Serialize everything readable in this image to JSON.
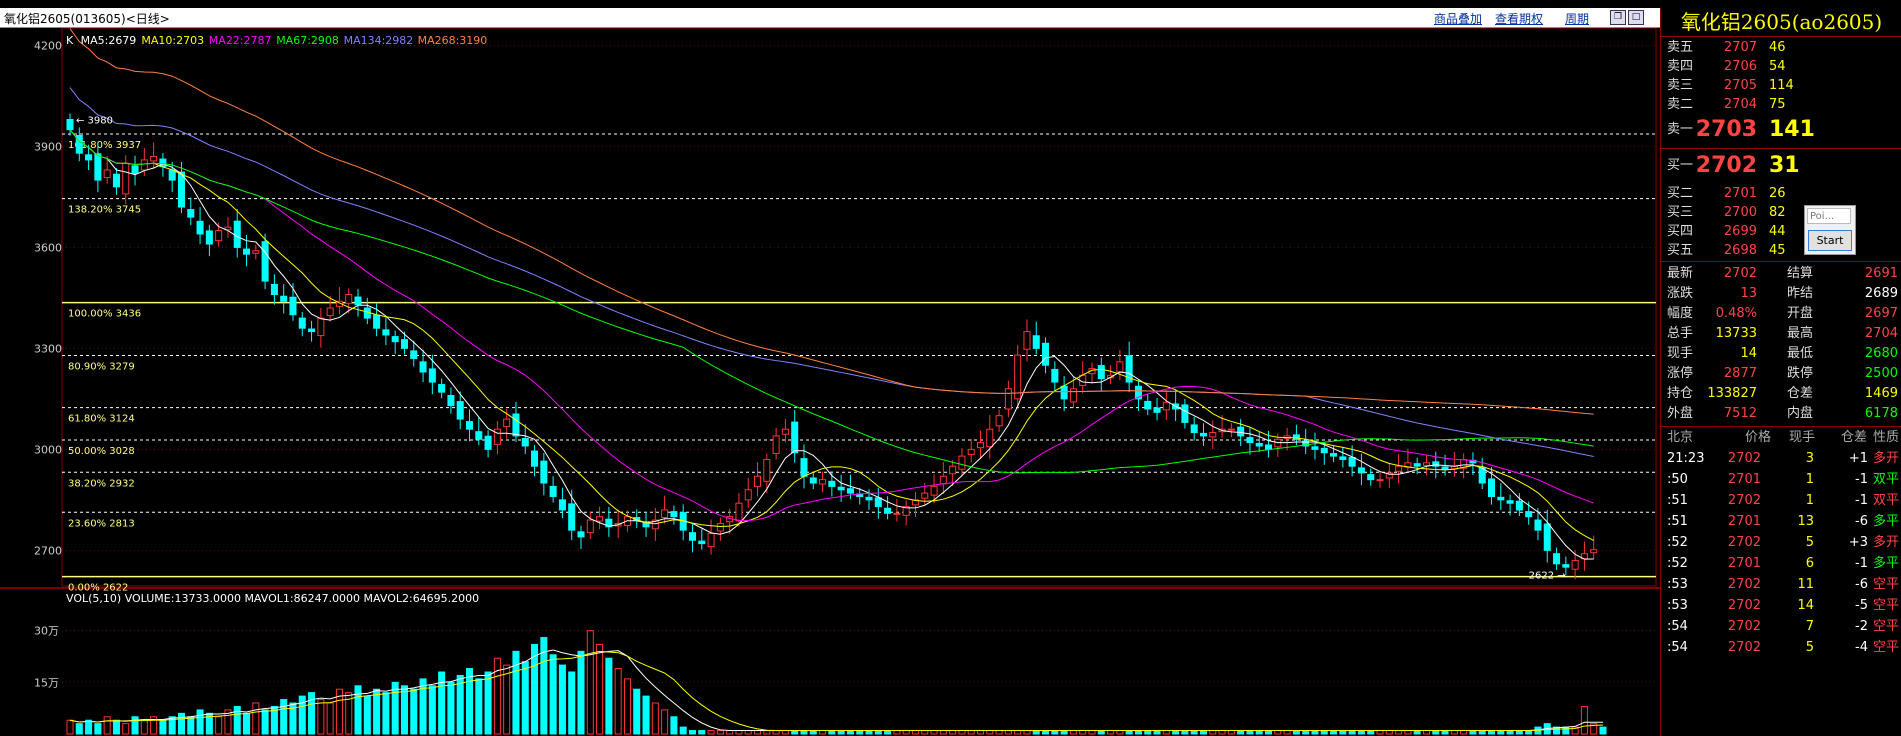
{
  "window": {
    "title": "氧化铝2605(013605)<日线>",
    "links": [
      "商品叠加",
      "查看期权",
      "周期"
    ]
  },
  "chart_data": [
    {
      "type": "candlestick",
      "title": "",
      "legend": [
        {
          "text": "K",
          "color": "#ffffff"
        },
        {
          "text": "MA5:2679",
          "color": "#ffffff"
        },
        {
          "text": "MA10:2703",
          "color": "#ffff00"
        },
        {
          "text": "MA22:2787",
          "color": "#ff00ff"
        },
        {
          "text": "MA67:2908",
          "color": "#00ff00"
        },
        {
          "text": "MA134:2982",
          "color": "#8080ff"
        },
        {
          "text": "MA268:3190",
          "color": "#ff8040"
        }
      ],
      "yticks": [
        4200,
        3900,
        3600,
        3300,
        3000,
        2700
      ],
      "ylim": [
        2600,
        4240
      ],
      "fib_levels": [
        {
          "label": "161.80% 3937",
          "value": 3937,
          "solid": false
        },
        {
          "label": "138.20% 3745",
          "value": 3745,
          "solid": false
        },
        {
          "label": "100.00% 3436",
          "value": 3436,
          "solid": true
        },
        {
          "label": "80.90% 3279",
          "value": 3279,
          "solid": false
        },
        {
          "label": "61.80% 3124",
          "value": 3124,
          "solid": false
        },
        {
          "label": "50.00% 3028",
          "value": 3028,
          "solid": false
        },
        {
          "label": "38.20% 2932",
          "value": 2932,
          "solid": false
        },
        {
          "label": "23.60% 2813",
          "value": 2813,
          "solid": false
        },
        {
          "label": "0.00% 2622",
          "value": 2622,
          "solid": true
        }
      ],
      "annotations": [
        {
          "text": "3980",
          "value": 3980
        },
        {
          "text": "2622",
          "value": 2622
        }
      ],
      "close": [
        3950,
        3880,
        3860,
        3800,
        3830,
        3780,
        3850,
        3820,
        3860,
        3870,
        3840,
        3800,
        3720,
        3690,
        3640,
        3610,
        3650,
        3660,
        3600,
        3580,
        3590,
        3500,
        3460,
        3440,
        3400,
        3360,
        3350,
        3390,
        3420,
        3440,
        3460,
        3430,
        3390,
        3360,
        3340,
        3320,
        3300,
        3270,
        3230,
        3200,
        3170,
        3130,
        3090,
        3060,
        3030,
        3000,
        3060,
        3090,
        3040,
        3010,
        2950,
        2900,
        2860,
        2820,
        2760,
        2740,
        2790,
        2800,
        2770,
        2780,
        2800,
        2790,
        2770,
        2790,
        2820,
        2800,
        2760,
        2730,
        2720,
        2750,
        2780,
        2800,
        2840,
        2880,
        2920,
        2970,
        3040,
        3060,
        2990,
        2920,
        2900,
        2910,
        2890,
        2880,
        2870,
        2860,
        2850,
        2830,
        2810,
        2810,
        2830,
        2850,
        2870,
        2890,
        2920,
        2950,
        2980,
        3000,
        3020,
        3060,
        3100,
        3180,
        3280,
        3350,
        3300,
        3250,
        3200,
        3150,
        3180,
        3220,
        3240,
        3210,
        3220,
        3260,
        3200,
        3150,
        3120,
        3110,
        3140,
        3120,
        3080,
        3050,
        3040,
        3050,
        3060,
        3060,
        3040,
        3020,
        3010,
        3000,
        3030,
        3040,
        3030,
        3010,
        3000,
        2990,
        2980,
        2970,
        2950,
        2930,
        2910,
        2910,
        2930,
        2950,
        2960,
        2950,
        2960,
        2950,
        2940,
        2950,
        2970,
        2960,
        2900,
        2860,
        2850,
        2840,
        2820,
        2800,
        2760,
        2700,
        2660,
        2650,
        2670,
        2690,
        2702
      ],
      "volume_title": "VOL(5,10) VOLUME:13733.0000 MAVOL1:86247.0000 MAVOL2:64695.2000",
      "volume_yticks": [
        "30万",
        "15万"
      ],
      "volume": [
        4,
        3,
        4,
        3,
        5,
        4,
        3,
        5,
        4,
        5,
        4,
        5,
        6,
        5,
        7,
        6,
        5,
        7,
        8,
        6,
        9,
        7,
        8,
        10,
        9,
        11,
        12,
        10,
        9,
        13,
        12,
        14,
        11,
        13,
        12,
        15,
        14,
        13,
        16,
        14,
        18,
        15,
        17,
        19,
        16,
        18,
        22,
        20,
        24,
        21,
        26,
        28,
        23,
        20,
        18,
        24,
        30,
        26,
        22,
        19,
        16,
        13,
        11,
        9,
        7,
        5,
        2,
        1,
        1,
        1,
        1,
        1,
        1,
        1,
        1,
        1,
        1,
        1,
        1,
        1,
        1,
        1,
        1,
        1,
        1,
        1,
        1,
        1,
        1,
        1,
        1,
        1,
        1,
        1,
        1,
        1,
        1,
        1,
        1,
        1,
        1,
        1,
        1,
        1,
        1,
        1,
        1,
        1,
        1,
        1,
        1,
        1,
        1,
        1,
        1,
        1,
        1,
        1,
        1,
        1,
        1,
        1,
        1,
        1,
        1,
        1,
        1,
        1,
        1,
        1,
        1,
        1,
        1,
        1,
        1,
        1,
        1,
        1,
        1,
        1,
        1,
        1,
        1,
        1,
        1,
        1,
        1,
        1,
        1,
        1,
        1,
        1,
        1,
        1,
        1,
        1,
        1,
        1,
        2,
        3,
        2,
        2,
        2,
        8,
        3,
        2
      ]
    }
  ],
  "quote": {
    "title": "氧化铝2605(ao2605)",
    "asks": [
      {
        "label": "卖五",
        "price": "2707",
        "vol": "46"
      },
      {
        "label": "卖四",
        "price": "2706",
        "vol": "54"
      },
      {
        "label": "卖三",
        "price": "2705",
        "vol": "114"
      },
      {
        "label": "卖二",
        "price": "2704",
        "vol": "75"
      }
    ],
    "ask1": {
      "label": "卖一",
      "price": "2703",
      "vol": "141"
    },
    "bid1": {
      "label": "买一",
      "price": "2702",
      "vol": "31"
    },
    "bids": [
      {
        "label": "买二",
        "price": "2701",
        "vol": "26"
      },
      {
        "label": "买三",
        "price": "2700",
        "vol": "82"
      },
      {
        "label": "买四",
        "price": "2699",
        "vol": "44"
      },
      {
        "label": "买五",
        "price": "2698",
        "vol": "45"
      }
    ],
    "stats": [
      {
        "l1": "最新",
        "v1": "2702",
        "c1": "#ff4444",
        "l2": "结算",
        "v2": "2691",
        "c2": "#ff4444"
      },
      {
        "l1": "涨跌",
        "v1": "13",
        "c1": "#ff4444",
        "l2": "昨结",
        "v2": "2689",
        "c2": "#ffffff"
      },
      {
        "l1": "幅度",
        "v1": "0.48%",
        "c1": "#ff4444",
        "l2": "开盘",
        "v2": "2697",
        "c2": "#ff4444"
      },
      {
        "l1": "总手",
        "v1": "13733",
        "c1": "#ffff00",
        "l2": "最高",
        "v2": "2704",
        "c2": "#ff4444"
      },
      {
        "l1": "现手",
        "v1": "14",
        "c1": "#ffff00",
        "l2": "最低",
        "v2": "2680",
        "c2": "#00ff00"
      },
      {
        "l1": "涨停",
        "v1": "2877",
        "c1": "#ff4444",
        "l2": "跌停",
        "v2": "2500",
        "c2": "#00ff00"
      },
      {
        "l1": "持仓",
        "v1": "133827",
        "c1": "#ffff00",
        "l2": "仓差",
        "v2": "1469",
        "c2": "#ffff00"
      },
      {
        "l1": "外盘",
        "v1": "7512",
        "c1": "#ff4444",
        "l2": "内盘",
        "v2": "6178",
        "c2": "#00ff00"
      }
    ],
    "tick_header": [
      "北京",
      "价格",
      "现手",
      "仓差",
      "性质"
    ],
    "ticks": [
      {
        "t": "21:23",
        "p": "2702",
        "v": "3",
        "d": "+1",
        "n": "多开",
        "pc": "#ff4444",
        "nc": "#ff4444",
        "dc": "#ffffff"
      },
      {
        "t": ":50",
        "p": "2701",
        "v": "1",
        "d": "-1",
        "n": "双平",
        "pc": "#ff4444",
        "nc": "#00ff00",
        "dc": "#ffffff"
      },
      {
        "t": ":51",
        "p": "2702",
        "v": "1",
        "d": "-1",
        "n": "双平",
        "pc": "#ff4444",
        "nc": "#ff4444",
        "dc": "#ffffff"
      },
      {
        "t": ":51",
        "p": "2701",
        "v": "13",
        "d": "-6",
        "n": "多平",
        "pc": "#ff4444",
        "nc": "#00ff00",
        "dc": "#ffffff"
      },
      {
        "t": ":52",
        "p": "2702",
        "v": "5",
        "d": "+3",
        "n": "多开",
        "pc": "#ff4444",
        "nc": "#ff4444",
        "dc": "#ffffff"
      },
      {
        "t": ":52",
        "p": "2701",
        "v": "6",
        "d": "-1",
        "n": "多平",
        "pc": "#ff4444",
        "nc": "#00ff00",
        "dc": "#ffffff"
      },
      {
        "t": ":53",
        "p": "2702",
        "v": "11",
        "d": "-6",
        "n": "空平",
        "pc": "#ff4444",
        "nc": "#ff4444",
        "dc": "#ffffff"
      },
      {
        "t": ":53",
        "p": "2702",
        "v": "14",
        "d": "-5",
        "n": "空平",
        "pc": "#ff4444",
        "nc": "#ff4444",
        "dc": "#ffffff"
      },
      {
        "t": ":54",
        "p": "2702",
        "v": "7",
        "d": "-2",
        "n": "空平",
        "pc": "#ff4444",
        "nc": "#ff4444",
        "dc": "#ffffff"
      },
      {
        "t": ":54",
        "p": "2702",
        "v": "5",
        "d": "-4",
        "n": "空平",
        "pc": "#ff4444",
        "nc": "#ff4444",
        "dc": "#ffffff"
      }
    ]
  },
  "popup": {
    "input_placeholder": "Poi...",
    "button": "Start"
  }
}
